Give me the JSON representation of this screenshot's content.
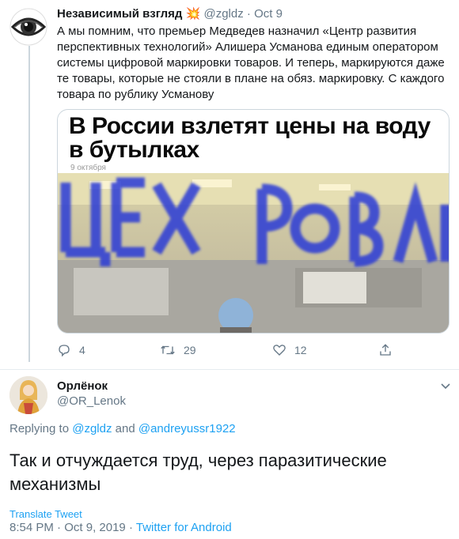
{
  "tweet1": {
    "author_name": "Независимый взгляд",
    "author_emoji": "💥",
    "handle": "@zgldz",
    "separator": "·",
    "date": "Oct 9",
    "text": "А мы помним, что премьер Медведев назначил «Центр развития перспективных технологий» Алишера Усманова единым оператором системы цифровой маркировки товаров. И теперь, маркируются даже те товары, которые не стояли в плане на обяз. маркировку. С каждого товара по рублику Усманову",
    "card": {
      "headline": "В России взлетят цены на воду в бутылках",
      "date": "9 октября",
      "photo_overlay_text": "ЦЕХ РОЗЛИВА"
    },
    "actions": {
      "replies": "4",
      "retweets": "29",
      "likes": "12"
    }
  },
  "tweet2": {
    "author_name": "Орлёнок",
    "handle": "@OR_Lenok",
    "replying_prefix": "Replying to",
    "reply_to_1": "@zgldz",
    "reply_and": "and",
    "reply_to_2": "@andreyussr1922",
    "text": "Так и отчуждается труд, через паразитические механизмы",
    "translate_label": "Translate Tweet",
    "time": "8:54 PM",
    "separator": "·",
    "date": "Oct 9, 2019",
    "source": "Twitter for Android"
  },
  "colors": {
    "link": "#1da1f2",
    "muted": "#657786",
    "border": "#ccd6dd",
    "text": "#14171a"
  },
  "icons": [
    "eye-logo-icon",
    "explosion-emoji",
    "reply-icon",
    "retweet-icon",
    "like-icon",
    "share-icon",
    "chevron-down-icon"
  ]
}
